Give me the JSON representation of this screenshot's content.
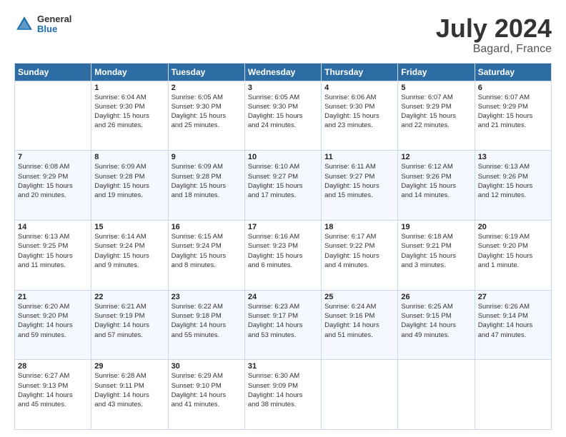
{
  "header": {
    "logo": {
      "general": "General",
      "blue": "Blue"
    },
    "title": "July 2024",
    "subtitle": "Bagard, France"
  },
  "weekdays": [
    "Sunday",
    "Monday",
    "Tuesday",
    "Wednesday",
    "Thursday",
    "Friday",
    "Saturday"
  ],
  "weeks": [
    [
      {
        "day": "",
        "info": ""
      },
      {
        "day": "1",
        "info": "Sunrise: 6:04 AM\nSunset: 9:30 PM\nDaylight: 15 hours\nand 26 minutes."
      },
      {
        "day": "2",
        "info": "Sunrise: 6:05 AM\nSunset: 9:30 PM\nDaylight: 15 hours\nand 25 minutes."
      },
      {
        "day": "3",
        "info": "Sunrise: 6:05 AM\nSunset: 9:30 PM\nDaylight: 15 hours\nand 24 minutes."
      },
      {
        "day": "4",
        "info": "Sunrise: 6:06 AM\nSunset: 9:30 PM\nDaylight: 15 hours\nand 23 minutes."
      },
      {
        "day": "5",
        "info": "Sunrise: 6:07 AM\nSunset: 9:29 PM\nDaylight: 15 hours\nand 22 minutes."
      },
      {
        "day": "6",
        "info": "Sunrise: 6:07 AM\nSunset: 9:29 PM\nDaylight: 15 hours\nand 21 minutes."
      }
    ],
    [
      {
        "day": "7",
        "info": "Sunrise: 6:08 AM\nSunset: 9:29 PM\nDaylight: 15 hours\nand 20 minutes."
      },
      {
        "day": "8",
        "info": "Sunrise: 6:09 AM\nSunset: 9:28 PM\nDaylight: 15 hours\nand 19 minutes."
      },
      {
        "day": "9",
        "info": "Sunrise: 6:09 AM\nSunset: 9:28 PM\nDaylight: 15 hours\nand 18 minutes."
      },
      {
        "day": "10",
        "info": "Sunrise: 6:10 AM\nSunset: 9:27 PM\nDaylight: 15 hours\nand 17 minutes."
      },
      {
        "day": "11",
        "info": "Sunrise: 6:11 AM\nSunset: 9:27 PM\nDaylight: 15 hours\nand 15 minutes."
      },
      {
        "day": "12",
        "info": "Sunrise: 6:12 AM\nSunset: 9:26 PM\nDaylight: 15 hours\nand 14 minutes."
      },
      {
        "day": "13",
        "info": "Sunrise: 6:13 AM\nSunset: 9:26 PM\nDaylight: 15 hours\nand 12 minutes."
      }
    ],
    [
      {
        "day": "14",
        "info": "Sunrise: 6:13 AM\nSunset: 9:25 PM\nDaylight: 15 hours\nand 11 minutes."
      },
      {
        "day": "15",
        "info": "Sunrise: 6:14 AM\nSunset: 9:24 PM\nDaylight: 15 hours\nand 9 minutes."
      },
      {
        "day": "16",
        "info": "Sunrise: 6:15 AM\nSunset: 9:24 PM\nDaylight: 15 hours\nand 8 minutes."
      },
      {
        "day": "17",
        "info": "Sunrise: 6:16 AM\nSunset: 9:23 PM\nDaylight: 15 hours\nand 6 minutes."
      },
      {
        "day": "18",
        "info": "Sunrise: 6:17 AM\nSunset: 9:22 PM\nDaylight: 15 hours\nand 4 minutes."
      },
      {
        "day": "19",
        "info": "Sunrise: 6:18 AM\nSunset: 9:21 PM\nDaylight: 15 hours\nand 3 minutes."
      },
      {
        "day": "20",
        "info": "Sunrise: 6:19 AM\nSunset: 9:20 PM\nDaylight: 15 hours\nand 1 minute."
      }
    ],
    [
      {
        "day": "21",
        "info": "Sunrise: 6:20 AM\nSunset: 9:20 PM\nDaylight: 14 hours\nand 59 minutes."
      },
      {
        "day": "22",
        "info": "Sunrise: 6:21 AM\nSunset: 9:19 PM\nDaylight: 14 hours\nand 57 minutes."
      },
      {
        "day": "23",
        "info": "Sunrise: 6:22 AM\nSunset: 9:18 PM\nDaylight: 14 hours\nand 55 minutes."
      },
      {
        "day": "24",
        "info": "Sunrise: 6:23 AM\nSunset: 9:17 PM\nDaylight: 14 hours\nand 53 minutes."
      },
      {
        "day": "25",
        "info": "Sunrise: 6:24 AM\nSunset: 9:16 PM\nDaylight: 14 hours\nand 51 minutes."
      },
      {
        "day": "26",
        "info": "Sunrise: 6:25 AM\nSunset: 9:15 PM\nDaylight: 14 hours\nand 49 minutes."
      },
      {
        "day": "27",
        "info": "Sunrise: 6:26 AM\nSunset: 9:14 PM\nDaylight: 14 hours\nand 47 minutes."
      }
    ],
    [
      {
        "day": "28",
        "info": "Sunrise: 6:27 AM\nSunset: 9:13 PM\nDaylight: 14 hours\nand 45 minutes."
      },
      {
        "day": "29",
        "info": "Sunrise: 6:28 AM\nSunset: 9:11 PM\nDaylight: 14 hours\nand 43 minutes."
      },
      {
        "day": "30",
        "info": "Sunrise: 6:29 AM\nSunset: 9:10 PM\nDaylight: 14 hours\nand 41 minutes."
      },
      {
        "day": "31",
        "info": "Sunrise: 6:30 AM\nSunset: 9:09 PM\nDaylight: 14 hours\nand 38 minutes."
      },
      {
        "day": "",
        "info": ""
      },
      {
        "day": "",
        "info": ""
      },
      {
        "day": "",
        "info": ""
      }
    ]
  ]
}
